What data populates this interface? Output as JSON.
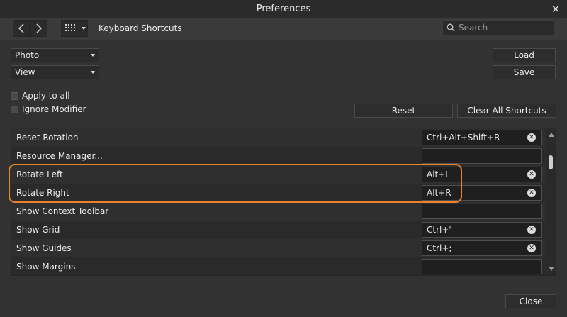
{
  "window": {
    "title": "Preferences"
  },
  "toolbar": {
    "section_title": "Keyboard Shortcuts"
  },
  "search": {
    "placeholder": "Search",
    "value": ""
  },
  "selects": {
    "app": "Photo",
    "category": "View"
  },
  "buttons": {
    "load": "Load",
    "save": "Save",
    "reset": "Reset",
    "clear_all": "Clear All Shortcuts",
    "close": "Close"
  },
  "options": {
    "apply_to_all": "Apply to all",
    "ignore_modifier": "Ignore Modifier"
  },
  "shortcuts": [
    {
      "label": "Reset Rotation",
      "shortcut": "Ctrl+Alt+Shift+R"
    },
    {
      "label": "Resource Manager...",
      "shortcut": ""
    },
    {
      "label": "Rotate Left",
      "shortcut": "Alt+L"
    },
    {
      "label": "Rotate Right",
      "shortcut": "Alt+R"
    },
    {
      "label": "Show Context Toolbar",
      "shortcut": ""
    },
    {
      "label": "Show Grid",
      "shortcut": "Ctrl+'"
    },
    {
      "label": "Show Guides",
      "shortcut": "Ctrl+;"
    },
    {
      "label": "Show Margins",
      "shortcut": ""
    }
  ],
  "colors": {
    "highlight": "#e8832a",
    "background": "#323232"
  }
}
